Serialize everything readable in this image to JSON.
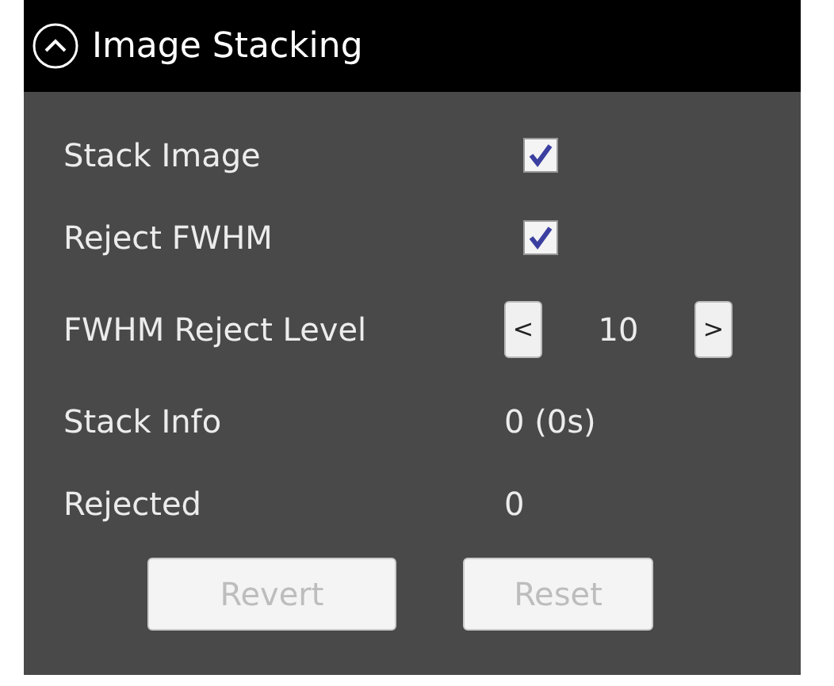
{
  "panel": {
    "title": "Image Stacking",
    "expanded": true
  },
  "rows": [
    {
      "kind": "checkbox",
      "label": "Stack Image",
      "checked": true
    },
    {
      "kind": "checkbox",
      "label": "Reject FWHM",
      "checked": true
    },
    {
      "kind": "stepper",
      "label": "FWHM Reject Level",
      "decrement": "<",
      "value": "10",
      "increment": ">"
    },
    {
      "kind": "text",
      "label": "Stack Info",
      "value": "0 (0s)"
    },
    {
      "kind": "text",
      "label": "Rejected",
      "value": "0"
    }
  ],
  "buttons": [
    {
      "label": "Revert",
      "disabled": true
    },
    {
      "label": "Reset",
      "disabled": true
    }
  ]
}
